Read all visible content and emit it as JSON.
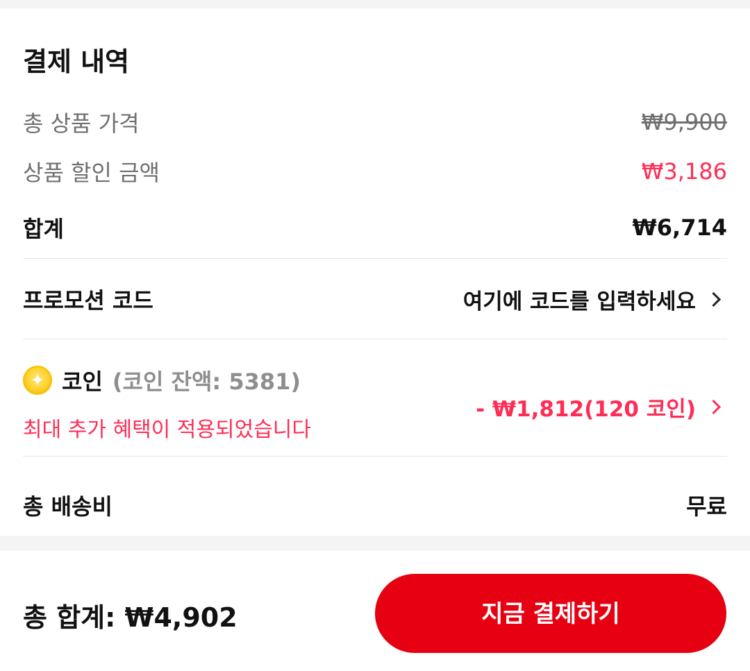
{
  "payment_summary": {
    "title": "결제 내역",
    "items": {
      "total_product_price_label": "총 상품 가격",
      "total_product_price_value": "₩9,900",
      "product_discount_label": "상품 할인 금액",
      "product_discount_value": "₩3,186",
      "subtotal_label": "합계",
      "subtotal_value": "₩6,714"
    },
    "promotion": {
      "label": "프로모션 코드",
      "cta": "여기에 코드를 입력하세요"
    },
    "coins": {
      "label": "코인",
      "balance_text": "(코인 잔액: 5381)",
      "benefit_text": "최대 추가 혜택이 적용되었습니다",
      "applied_text": "- ₩1,812(120 코인)"
    },
    "shipping": {
      "label": "총 배송비",
      "value": "무료"
    }
  },
  "footer": {
    "total_text": "총 합계:  ₩4,902",
    "pay_button_label": "지금 결제하기"
  },
  "icons": {
    "coin": "coin-icon",
    "chevron": "chevron-right-icon"
  },
  "colors": {
    "accent_red": "#e60012",
    "discount_pink": "#ff2d55",
    "text_primary": "#111111",
    "text_secondary": "#6f6f6f"
  }
}
